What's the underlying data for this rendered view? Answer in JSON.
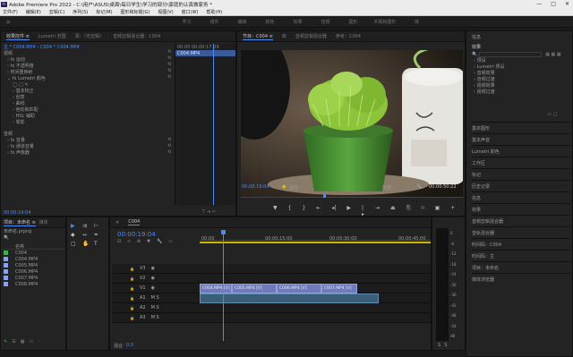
{
  "window": {
    "title": "Adobe Premiere Pro 2022 - C:\\用户\\ASUS\\桌面\\每日学生\\学习的部分\\家庭的认真做家务 *",
    "controls": [
      "—",
      "□",
      "✕"
    ]
  },
  "menu": [
    "文件(F)",
    "编辑(E)",
    "剪辑(C)",
    "序列(S)",
    "标记(M)",
    "图形和标题(G)",
    "视图(V)",
    "窗口(W)",
    "帮助(H)"
  ],
  "workspaces": [
    "学习",
    "组件",
    "编辑",
    "颜色",
    "效果",
    "音频",
    "图形",
    "字幕和图形",
    "库"
  ],
  "effects_panel": {
    "tabs": [
      "效果控件 ≡",
      "Lumetri 范围",
      "源：（无剪辑）",
      "音频剪辑混合器：C004"
    ],
    "breadcrumb": "主 * C004.MP4 › C004 * C004.MP4",
    "video_header": "视频",
    "clip_header": "00:00  00:00:17:09",
    "clip_name": "C004.MP4",
    "items": [
      "fx 运动",
      "fx 不透明度",
      "时间重映射",
      "fx Lumetri 颜色"
    ],
    "lumetri_sub": [
      "基本校正",
      "创意",
      "曲线",
      "色轮和匹配",
      "HSL 辅助",
      "晕影"
    ],
    "audio_header": "音频",
    "audio_items": [
      "fx 音量",
      "fx 通道音量",
      "fx 声像器"
    ],
    "timecode": "00:00:19:04"
  },
  "program_panel": {
    "tabs": [
      "节目：C004 ≡",
      "库",
      "音频剪辑混合器",
      "参考：C004"
    ],
    "timecode": "00:00:19:04",
    "fit": "适合",
    "quality": "完整",
    "duration": "00:00:50:22"
  },
  "right_panel": {
    "tabs": [
      "信息",
      "效果"
    ],
    "search_placeholder": "搜索",
    "tree": [
      "预设",
      "Lumetri 预设",
      "音频效果",
      "音频过渡",
      "视频效果",
      "视频过渡"
    ],
    "sections": [
      "基本图形",
      "基本声音",
      "Lumetri 颜色",
      "工作区",
      "标记",
      "历史记录",
      "信息",
      "效果",
      "音频剪辑混合器",
      "音轨混合器",
      "时间码：C004",
      "时间码：主",
      "项目：未命名",
      "媒体浏览器"
    ]
  },
  "project_panel": {
    "tabs": [
      "项目：未命名 ≡",
      "媒体"
    ],
    "file": "未命名.prproj",
    "name_col": "名称",
    "items": [
      "C004",
      "C004.MP4",
      "C005.MP4",
      "C006.MP4",
      "C007.MP4",
      "C008.MP4"
    ],
    "item_colors": [
      "#3cb44b",
      "#8aa0e8",
      "#8aa0e8",
      "#8aa0e8",
      "#8aa0e8",
      "#8aa0e8"
    ]
  },
  "timeline": {
    "tab": "C004",
    "timecode": "00:00:19:04",
    "ruler": [
      "00:00",
      "00:00:15:00",
      "00:00:30:00",
      "00:00:45:00"
    ],
    "video_tracks": [
      "V3",
      "V2",
      "V1"
    ],
    "audio_tracks": [
      "A1",
      "A2",
      "A3"
    ],
    "mix": "混合",
    "mix_value": "0.0",
    "clips": [
      "C004.MP4 [V]",
      "C005.MP4 [V]",
      "C006.MP4 [V]",
      "C007.MP4 [V]"
    ],
    "meter_labels": [
      "0",
      "-6",
      "-12",
      "-18",
      "-24",
      "-30",
      "-36",
      "-42",
      "-48",
      "-54",
      "dB"
    ],
    "meter_solo": [
      "S",
      "S"
    ]
  },
  "colors": {
    "accent": "#4a8cf7",
    "clip": "#6e7bb8",
    "audio": "#3b5d78",
    "playhead": "#4a8cf7"
  }
}
